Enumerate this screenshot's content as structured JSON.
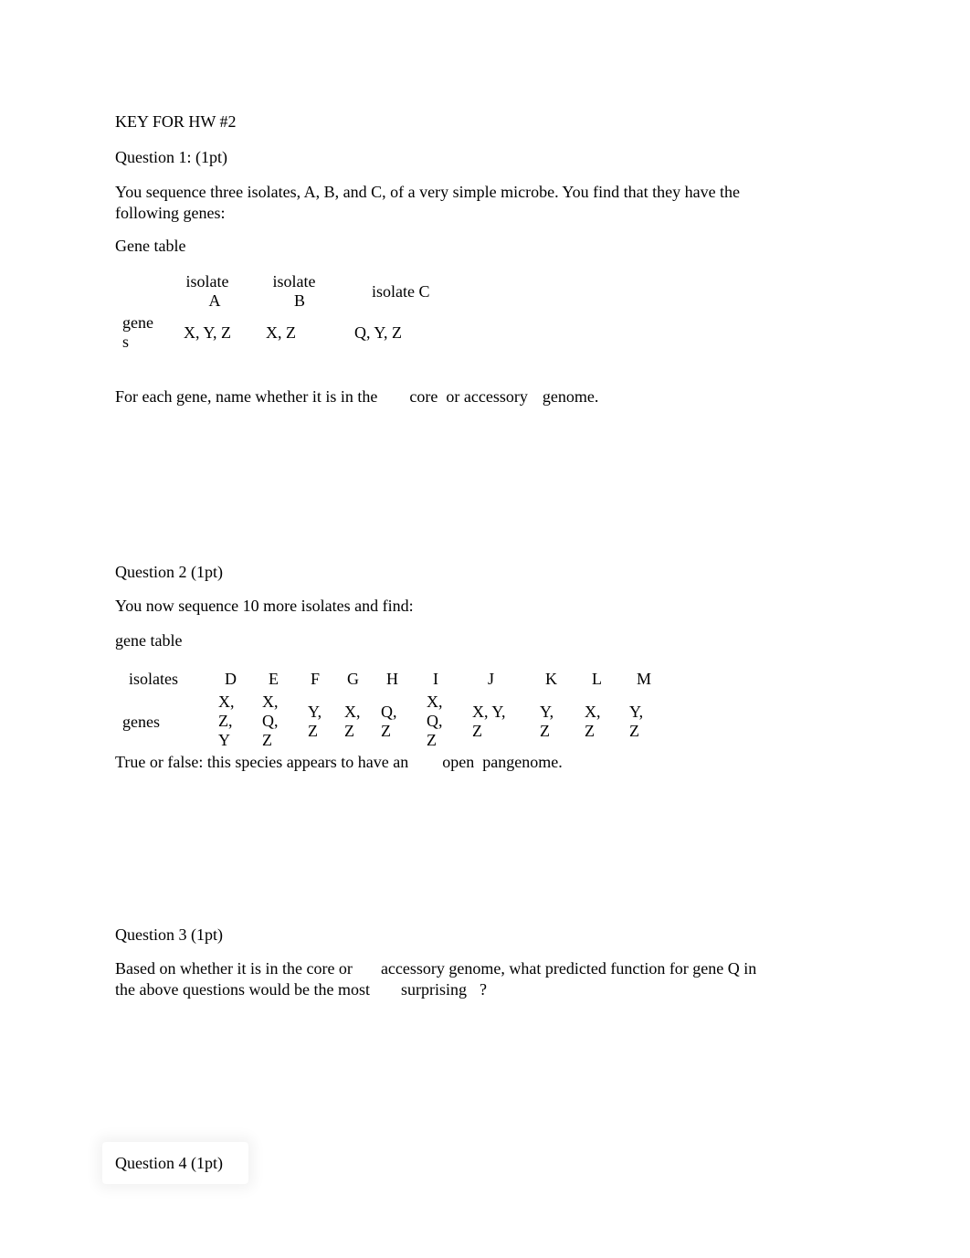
{
  "document": {
    "title": "KEY FOR HW #2",
    "questions": [
      {
        "heading": "Question 1: (1pt)",
        "prompt_line1": "You sequence three isolates, A, B, and C, of a very simple microbe. You find that they have the",
        "prompt_line2": "following genes:",
        "table_caption": "Gene table",
        "table": {
          "headers": [
            "isolate A",
            "isolate B",
            "isolate C"
          ],
          "header_lines": [
            [
              "isolate",
              "A"
            ],
            [
              "isolate",
              "B"
            ],
            [
              "isolate C"
            ]
          ],
          "row_label_lines": [
            "gene",
            "s"
          ],
          "row_label": "genes",
          "values": [
            "X, Y, Z",
            "X, Z",
            "Q, Y, Z"
          ]
        },
        "question_parts": [
          "For each gene, name whether it is in the",
          "core",
          "or accessory",
          "genome."
        ]
      },
      {
        "heading": "Question 2 (1pt)",
        "prompt": "You now sequence 10 more isolates and find:",
        "table_caption": "gene table",
        "table": {
          "row1_label": "isolates",
          "row2_label": "genes",
          "isolates": [
            "D",
            "E",
            "F",
            "G",
            "H",
            "I",
            "J",
            "K",
            "L",
            "M"
          ],
          "genes": [
            [
              "X,",
              "Z,",
              "Y"
            ],
            [
              "X,",
              "Q,",
              "Z"
            ],
            [
              "Y,",
              "Z"
            ],
            [
              "X,",
              "Z"
            ],
            [
              "Q,",
              "Z"
            ],
            [
              "X,",
              "Q,",
              "Z"
            ],
            [
              "X, Y,",
              "Z"
            ],
            [
              "Y,",
              "Z"
            ],
            [
              "X,",
              "Z"
            ],
            [
              "Y,",
              "Z"
            ]
          ]
        },
        "question_parts": [
          "True or false: this species appears to have an",
          "open",
          "pangenome."
        ]
      },
      {
        "heading": "Question 3 (1pt)",
        "line1_parts": [
          "Based on whether it is in the core or",
          "accessory genome, what predicted function for gene Q in"
        ],
        "line2_parts": [
          "the above questions would be the most",
          "surprising",
          "?"
        ]
      },
      {
        "heading": "Question 4 (1pt)"
      }
    ]
  }
}
